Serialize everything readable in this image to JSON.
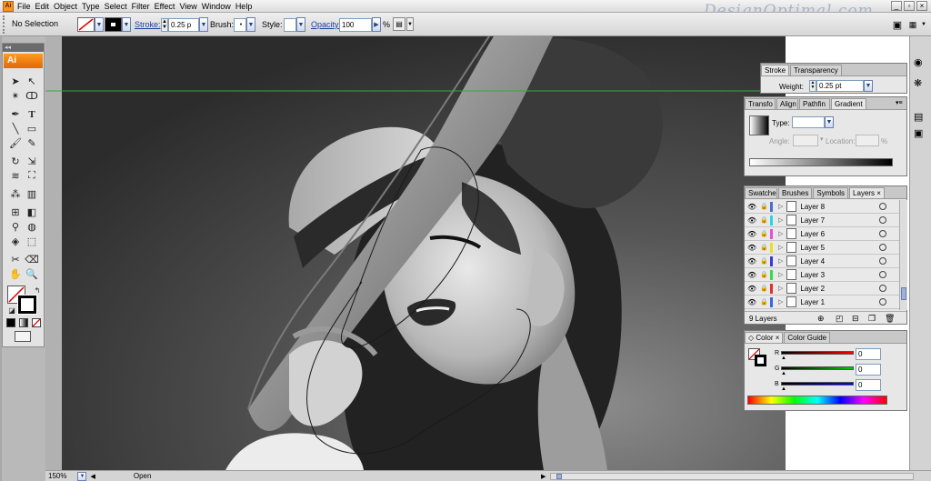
{
  "app": {
    "icon": "Ai"
  },
  "menu": [
    "File",
    "Edit",
    "Object",
    "Type",
    "Select",
    "Filter",
    "Effect",
    "View",
    "Window",
    "Help"
  ],
  "watermark": "DesignOptimal.com",
  "control": {
    "selection": "No Selection",
    "stroke_label": "Stroke:",
    "stroke_value": "0.25 p",
    "brush_label": "Brush:",
    "style_label": "Style:",
    "opacity_label": "Opacity:",
    "opacity_value": "100",
    "percent": "%"
  },
  "toolbox": {
    "logo": "Ai",
    "type_tool": "T"
  },
  "stroke_panel": {
    "tabs": [
      "Stroke",
      "Transparency"
    ],
    "weight_label": "Weight:",
    "weight_value": "0.25 pt"
  },
  "gradient_panel": {
    "tabs": [
      "Transfo",
      "Align",
      "Pathfin",
      "Gradient"
    ],
    "type_label": "Type:",
    "angle_label": "Angle:",
    "location_label": "Location:",
    "percent": "%"
  },
  "layers_panel": {
    "tabs": [
      "Swatche",
      "Brushes",
      "Symbols",
      "Layers"
    ],
    "layers": [
      {
        "name": "Layer 8",
        "color": "#4a6cd4"
      },
      {
        "name": "Layer 7",
        "color": "#27d4e8"
      },
      {
        "name": "Layer 6",
        "color": "#e050d8"
      },
      {
        "name": "Layer 5",
        "color": "#e8e020"
      },
      {
        "name": "Layer 4",
        "color": "#3a3ad0"
      },
      {
        "name": "Layer 3",
        "color": "#2ee040"
      },
      {
        "name": "Layer 2",
        "color": "#e03030"
      },
      {
        "name": "Layer 1",
        "color": "#3c64e0"
      }
    ],
    "count": "9 Layers"
  },
  "color_panel": {
    "tabs": [
      "Color",
      "Color Guide"
    ],
    "r_label": "R",
    "g_label": "G",
    "b_label": "B",
    "r_value": "0",
    "g_value": "0",
    "b_value": "0"
  },
  "status": {
    "zoom": "150%",
    "state": "Open"
  }
}
